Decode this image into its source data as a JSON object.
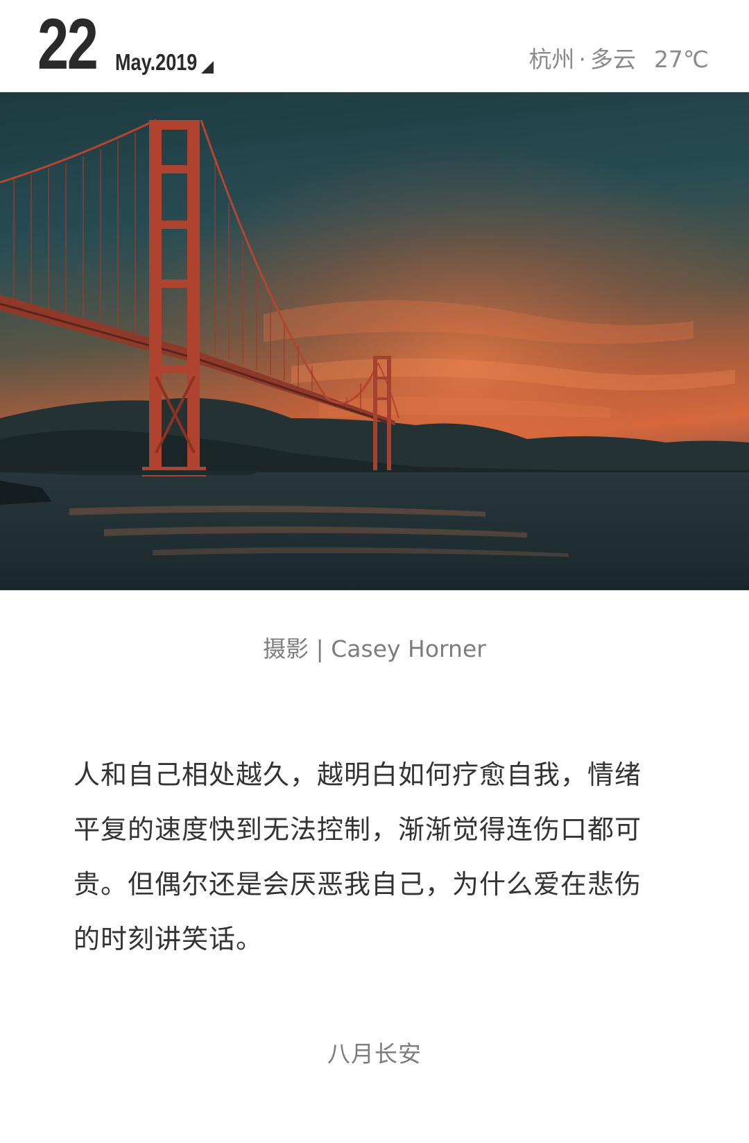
{
  "header": {
    "day": "22",
    "month_year": "May.2019",
    "dropdown_icon": "caret-triangle-icon",
    "weather": {
      "city": "杭州",
      "separator": "·",
      "condition": "多云",
      "temperature": "27℃"
    }
  },
  "photo": {
    "subject": "golden-gate-bridge-sunset"
  },
  "credit": "摄影 | Casey Horner",
  "quote": "人和自己相处越久，越明白如何疗愈自我，情绪平复的速度快到无法控制，渐渐觉得连伤口都可贵。但偶尔还是会厌恶我自己，为什么爱在悲伤的时刻讲笑话。",
  "author": "八月长安",
  "colors": {
    "text_dark": "#2a2a2a",
    "text_gray": "#7d7d7d",
    "bridge": "#a8402e",
    "sky_top": "#1f3d43",
    "sunset": "#e0643a"
  }
}
